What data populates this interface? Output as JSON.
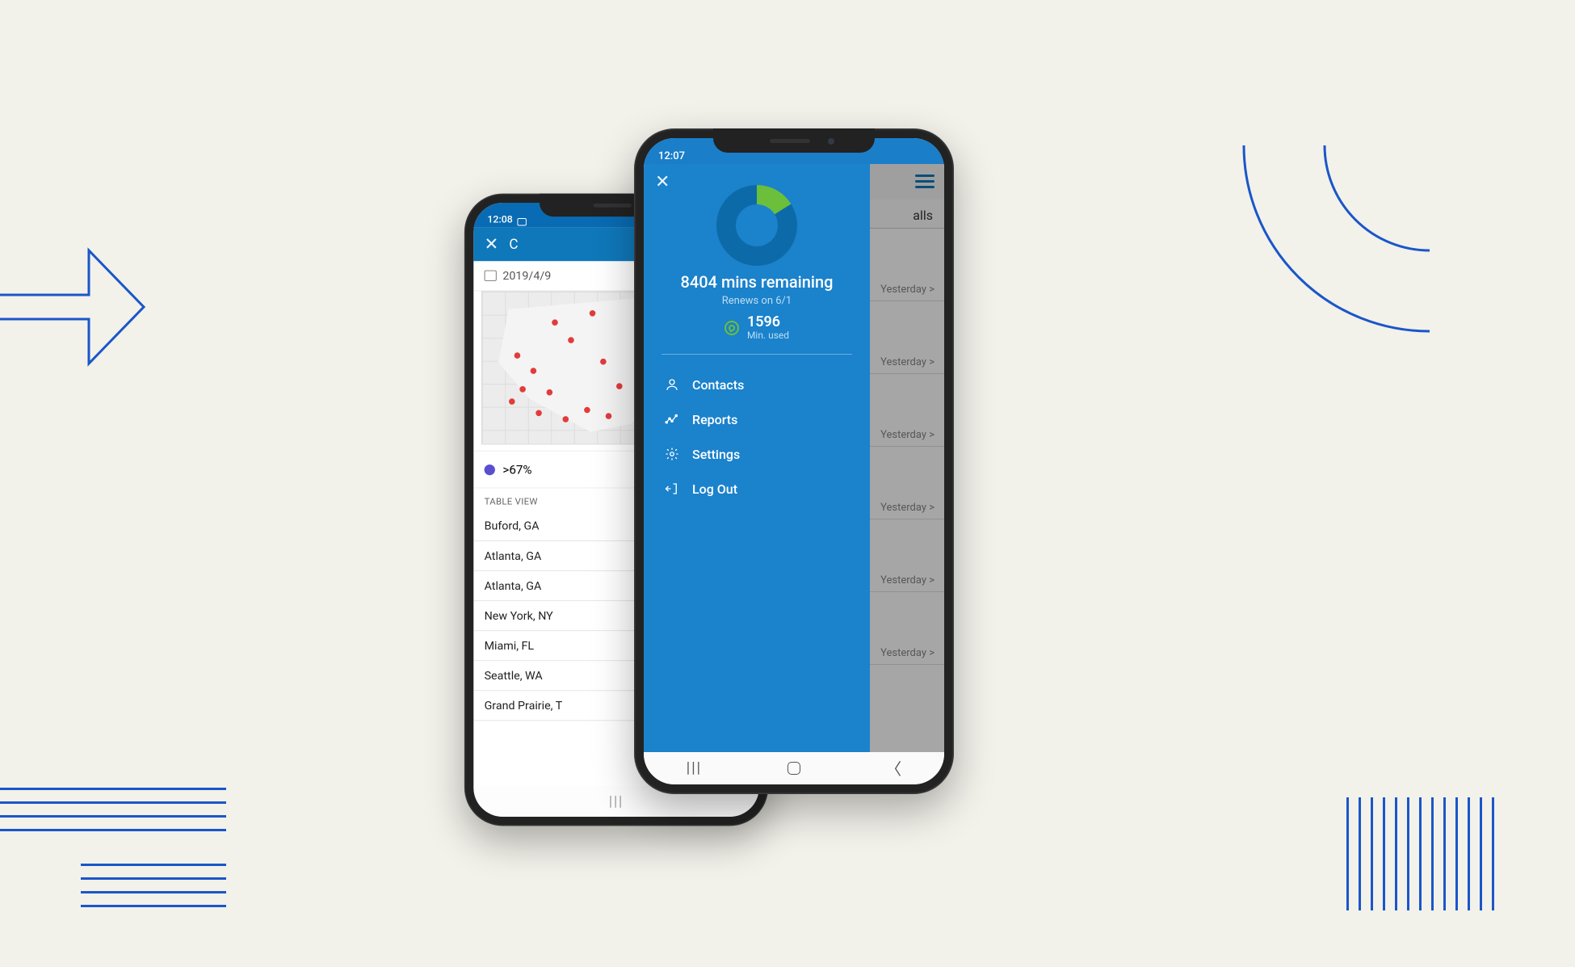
{
  "decoration": {
    "arrow": "arrow",
    "arc": "arc"
  },
  "backPhone": {
    "status_time": "12:08",
    "header_title_fragment": "C",
    "date_value": "2019/4/9",
    "legend_value": ">67%",
    "section_header": "TABLE VIEW",
    "rows": [
      "Buford, GA",
      "Atlanta, GA",
      "Atlanta, GA",
      "New York, NY",
      "Miami, FL",
      "Seattle, WA",
      "Grand Prairie, T"
    ]
  },
  "frontPhone": {
    "status_time": "12:07",
    "underlay": {
      "calls_header_fragment": "alls",
      "row_time_label": "Yesterday >"
    },
    "drawer": {
      "remaining": "8404 mins remaining",
      "renews": "Renews on 6/1",
      "used_number": "1596",
      "used_label": "Min. used",
      "menu": {
        "contacts": "Contacts",
        "reports": "Reports",
        "settings": "Settings",
        "logout": "Log Out"
      }
    },
    "nav": {
      "recent": "|||",
      "home": "□",
      "back": "‹"
    }
  }
}
